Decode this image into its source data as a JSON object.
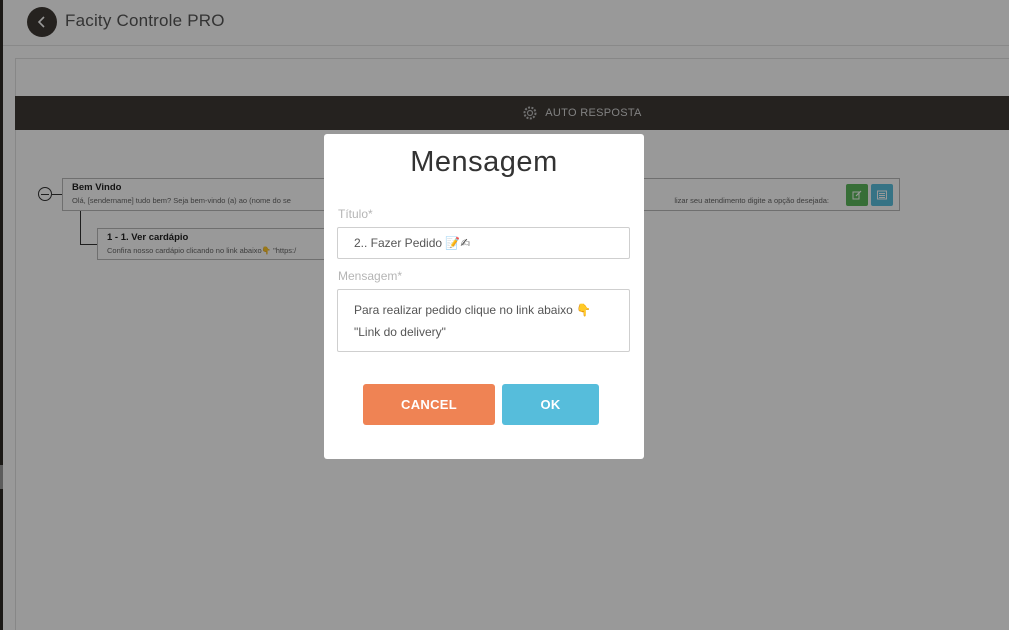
{
  "app": {
    "title": "Facity Controle PRO"
  },
  "panel": {
    "header": "AUTO RESPOSTA"
  },
  "tree": {
    "root": {
      "title": "Bem Vindo",
      "desc_left": "Olá, [sendername] tudo bem? Seja bem-vindo (a) ao (nome do se",
      "desc_right": "lizar seu atendimento digite a opção desejada:"
    },
    "child": {
      "title": "1 - 1. Ver cardápio",
      "desc": "Confira nosso cardápio clicando no link abaixo👇 \"https:/"
    }
  },
  "modal": {
    "title": "Mensagem",
    "titulo_label": "Título*",
    "titulo_value": "2.. Fazer Pedido 📝✍",
    "mensagem_label": "Mensagem*",
    "mensagem_line1": "Para realizar pedido clique no link abaixo 👇",
    "mensagem_line2": "\"Link do delivery\"",
    "cancel_label": "CANCEL",
    "ok_label": "OK"
  },
  "colors": {
    "header_bg": "#3f3a35",
    "cancel": "#ef8354",
    "ok": "#56bddb",
    "edit_btn": "#5cb85c",
    "list_btn": "#5bc0de"
  },
  "icons": {
    "back": "chevron-left-icon",
    "header": "gear-icon",
    "edit": "edit-icon",
    "list": "list-icon"
  }
}
